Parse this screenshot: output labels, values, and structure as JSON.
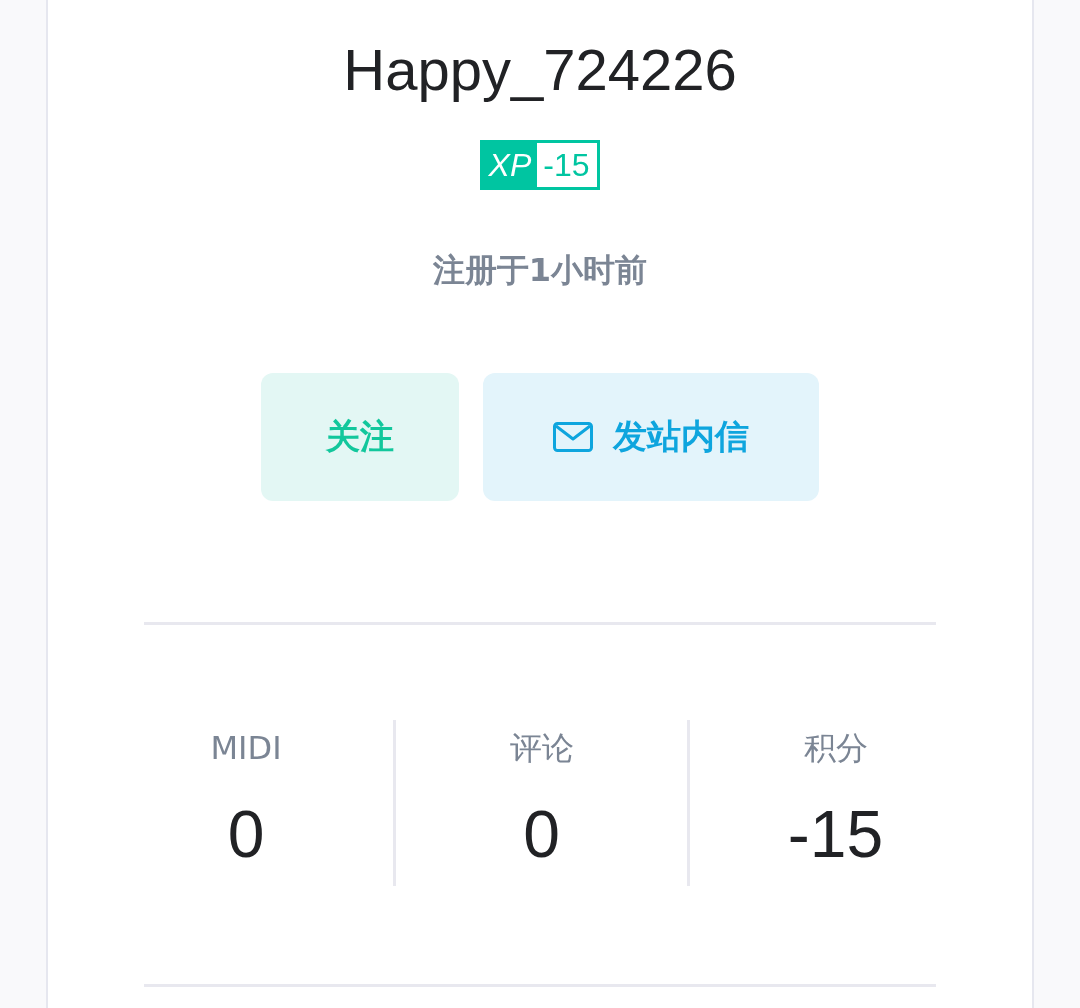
{
  "profile": {
    "username": "Happy_724226",
    "xp_badge": {
      "label": "XP",
      "value": "-15"
    },
    "registered": "注册于1小时前"
  },
  "buttons": [
    {
      "kind": "follow",
      "label": "关注"
    },
    {
      "kind": "message",
      "label": "发站内信"
    }
  ],
  "stats": [
    {
      "label": "MIDI",
      "value": "0"
    },
    {
      "label": "评论",
      "value": "0"
    },
    {
      "label": "积分",
      "value": "-15"
    }
  ]
}
